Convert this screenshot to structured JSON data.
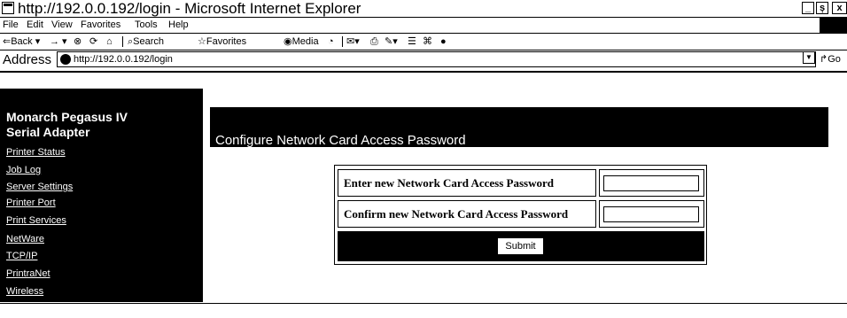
{
  "window": {
    "title": "http://192.0.0.192/login - Microsoft Internet Explorer",
    "controls": {
      "minimize": "_",
      "maximize": "ș",
      "close": "x"
    }
  },
  "menubar": [
    "File",
    "Edit",
    "View",
    "Favorites",
    "Tools",
    "Help"
  ],
  "toolbar": {
    "back": "⇐Back",
    "forward": "→",
    "stop": "⊗",
    "refresh": "⟳",
    "home": "⌂",
    "search": "Search",
    "favorites": "Favorites",
    "media": "Media"
  },
  "address": {
    "label": "Address",
    "value": "http://192.0.0.192/login",
    "go": "Go"
  },
  "sidebar": {
    "brand_line1": "Monarch Pegasus IV",
    "brand_line2": "Serial Adapter",
    "items": [
      {
        "label": "Printer Status"
      },
      {
        "label": "Job Log"
      },
      {
        "label": "Server Settings"
      },
      {
        "label": "Printer Port"
      },
      {
        "label": "Print Services"
      },
      {
        "label": "NetWare"
      },
      {
        "label": "TCP/IP"
      },
      {
        "label": "PrintraNet"
      },
      {
        "label": "Wireless"
      }
    ]
  },
  "main": {
    "title": "Configure Network Card Access Password",
    "form": {
      "new_password_label": "Enter new Network Card Access Password",
      "confirm_password_label": "Confirm new Network Card Access Password",
      "new_password_value": "",
      "confirm_password_value": "",
      "submit_label": "Submit"
    }
  }
}
